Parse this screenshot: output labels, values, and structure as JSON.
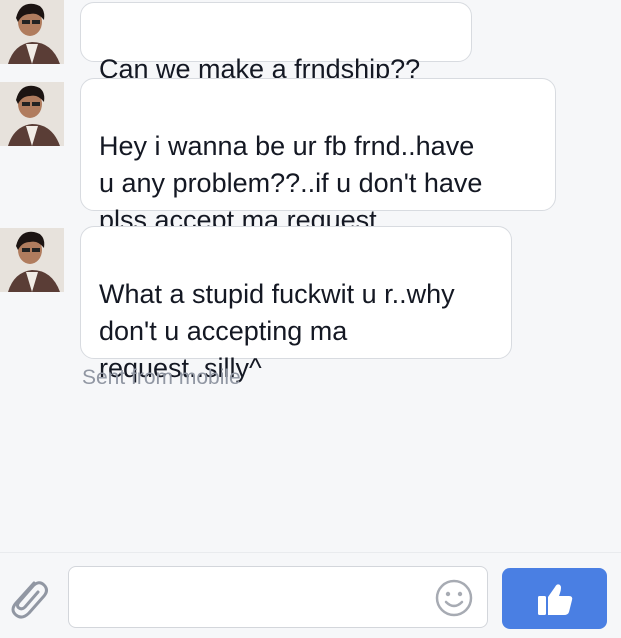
{
  "messages": [
    {
      "text": "Can we make a frndship??"
    },
    {
      "text": "Hey i wanna be ur fb frnd..have\nu any problem??..if u don't have\nplss accept ma request.."
    },
    {
      "text": "What a stupid fuckwit u r..why\ndon't u accepting ma\nrequest..silly^"
    }
  ],
  "status": {
    "sent_from": "Sent from mobile"
  },
  "composer": {
    "input_value": "",
    "placeholder": "",
    "attach_icon": "paperclip-icon",
    "emoji_icon": "smiley-icon",
    "like_icon": "thumbs-up-icon"
  },
  "colors": {
    "background": "#f6f7f9",
    "bubble": "#ffffff",
    "bubble_border": "#d8dbe0",
    "text": "#141823",
    "muted": "#9197a3",
    "like_button": "#4a7fe3"
  }
}
